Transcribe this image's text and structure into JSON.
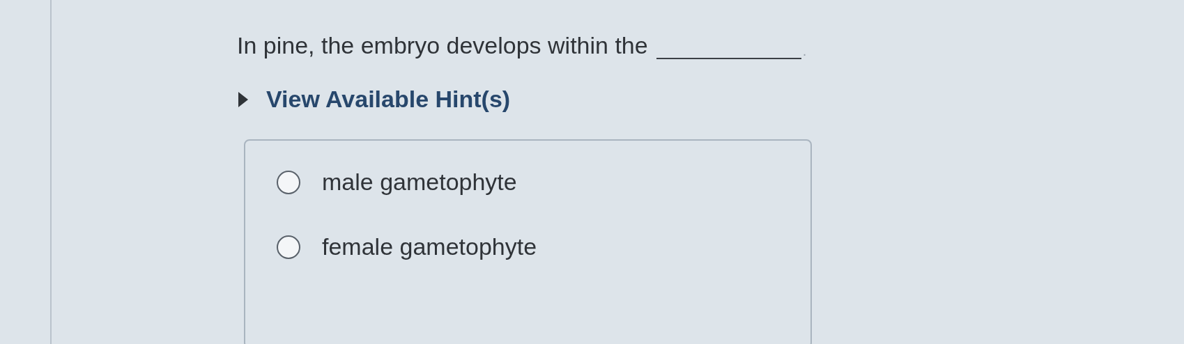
{
  "question": {
    "text": "In pine, the embryo develops within the",
    "end": "."
  },
  "hint": {
    "label": "View Available Hint(s)",
    "expanded": false
  },
  "options": [
    {
      "label": "male gametophyte",
      "selected": false
    },
    {
      "label": "female gametophyte",
      "selected": false
    }
  ]
}
